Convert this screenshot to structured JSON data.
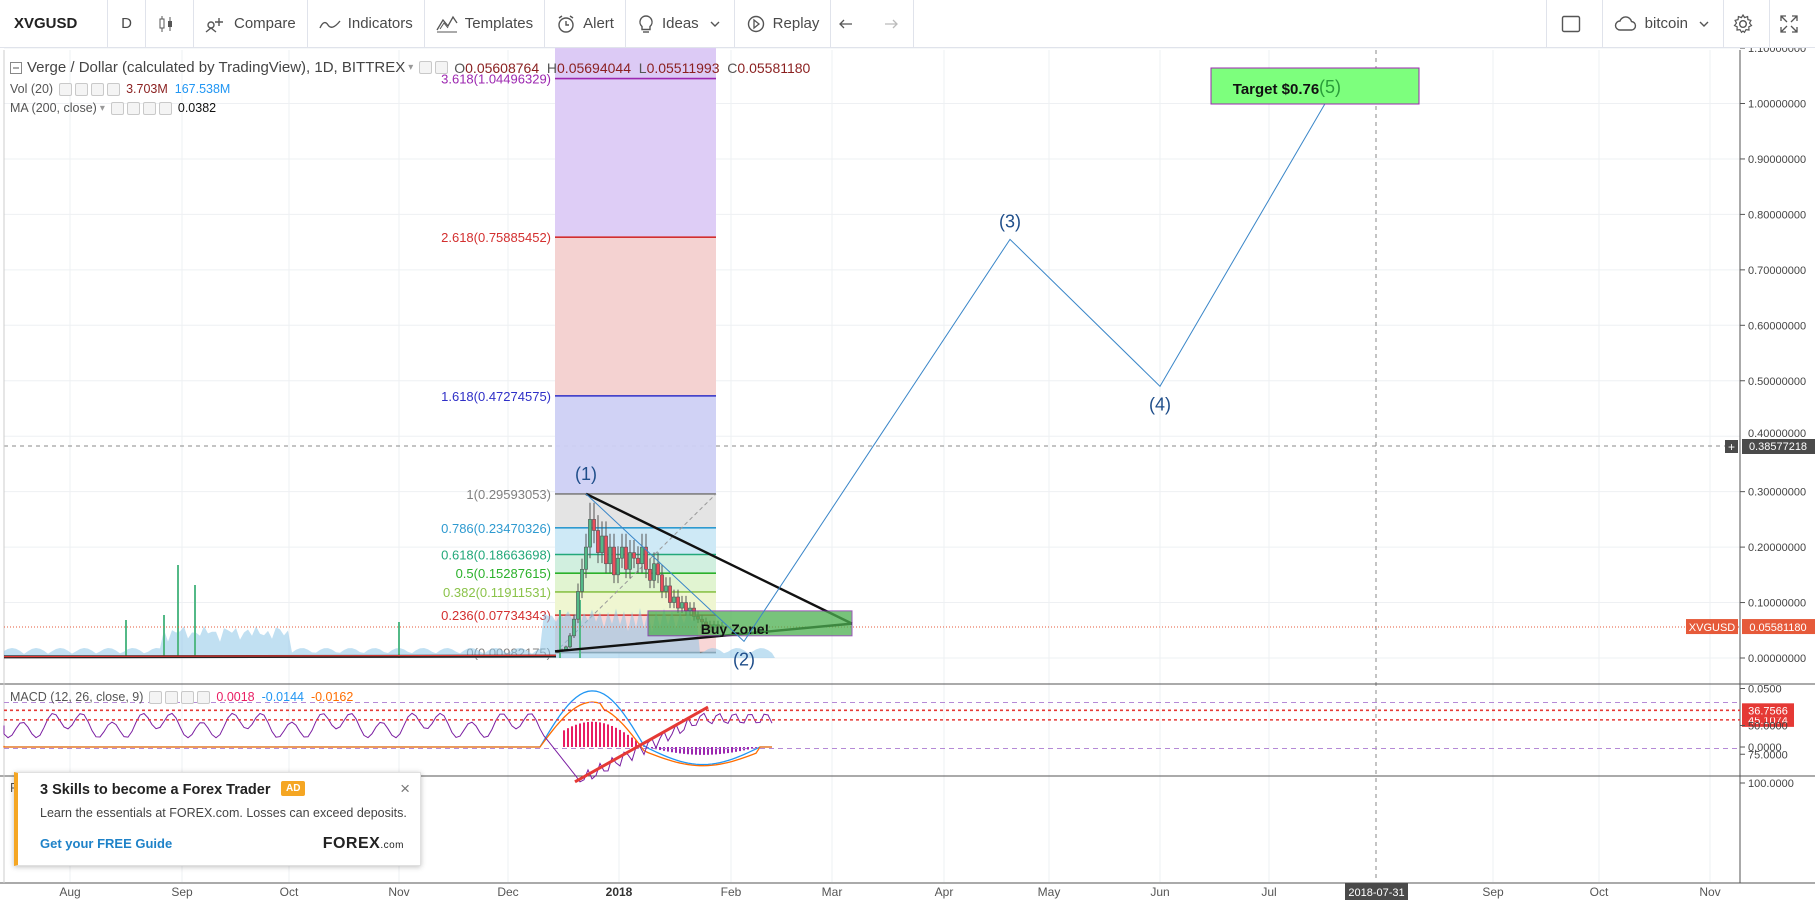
{
  "toolbar": {
    "symbol": "XVGUSD",
    "resolution": "D",
    "compare": "Compare",
    "indicators": "Indicators",
    "templates": "Templates",
    "alert": "Alert",
    "ideas": "Ideas",
    "replay": "Replay",
    "layout_name": "bitcoin",
    "icons": [
      "candles-icon",
      "compare-icon",
      "indicators-icon",
      "templates-icon",
      "alert-icon",
      "ideas-icon",
      "replay-icon",
      "undo-icon",
      "redo-icon",
      "fullscreen-layout-icon",
      "cloud-icon",
      "settings-icon",
      "fullscreen-icon"
    ]
  },
  "legend": {
    "main_title": "Verge / Dollar (calculated by TradingView), 1D, BITTREX",
    "o_label": "O",
    "o_value": "0.05608764",
    "h_label": "H",
    "h_value": "0.05694044",
    "l_label": "L",
    "l_value": "0.05511993",
    "c_label": "C",
    "c_value": "0.05581180",
    "vol_label": "Vol (20)",
    "vol_value1": "3.703M",
    "vol_value2": "167.538M",
    "ma_label": "MA (200, close)",
    "ma_value": "0.0382",
    "macd_label": "MACD (12, 26, close, 9)",
    "macd_value1": "0.0018",
    "macd_value2": "-0.0144",
    "macd_value3": "-0.0162",
    "rsi_label": "R"
  },
  "fib_levels": [
    {
      "label": "3.618(1.04496329)",
      "value": 1.04496329,
      "color": "#9c27b0"
    },
    {
      "label": "2.618(0.75885452)",
      "value": 0.75885452,
      "color": "#d32f2f"
    },
    {
      "label": "1.618(0.47274575)",
      "value": 0.47274575,
      "color": "#2f2fc7"
    },
    {
      "label": "1(0.29593053)",
      "value": 0.29593053,
      "color": "#808080"
    },
    {
      "label": "0.786(0.23470326)",
      "value": 0.23470326,
      "color": "#2e9ad0"
    },
    {
      "label": "0.618(0.18663698)",
      "value": 0.18663698,
      "color": "#22a87a"
    },
    {
      "label": "0.5(0.15287615)",
      "value": 0.15287615,
      "color": "#2bb12b"
    },
    {
      "label": "0.382(0.11911531)",
      "value": 0.11911531,
      "color": "#8bc34a"
    },
    {
      "label": "0.236(0.07734343)",
      "value": 0.07734343,
      "color": "#d32f2f"
    },
    {
      "label": "0(0.00982175)",
      "value": 0.00982175,
      "color": "#808080"
    }
  ],
  "waves": [
    "(1)",
    "(2)",
    "(3)",
    "(4)",
    "(5)"
  ],
  "annotations": {
    "target": "Target $0.76",
    "buy_zone": "Buy Zone!"
  },
  "price_axis": [
    "1.10000000",
    "1.00000000",
    "0.90000000",
    "0.80000000",
    "0.70000000",
    "0.60000000",
    "0.50000000",
    "0.30000000",
    "0.20000000",
    "0.10000000",
    "0.00000000"
  ],
  "price_axis_partial": "0.40000000",
  "crosshair_price": "0.38577218",
  "last_price_symbol": "XVGUSD",
  "last_price": "0.05581180",
  "macd_axis": [
    "0.0500",
    "0.0000"
  ],
  "rsi_axis": [
    "100.0000",
    "75.0000",
    "50.0000"
  ],
  "rsi_tags": [
    "45.1074",
    "36.7566"
  ],
  "time_axis": [
    "Aug",
    "Sep",
    "Oct",
    "Nov",
    "Dec",
    "2018",
    "Feb",
    "Mar",
    "Apr",
    "May",
    "Jun",
    "Jul",
    "Sep",
    "Oct",
    "Nov"
  ],
  "crosshair_date": "2018-07-31",
  "ad": {
    "title": "3 Skills to become a Forex Trader",
    "badge": "AD",
    "description": "Learn the essentials at FOREX.com. Losses can exceed deposits.",
    "cta": "Get your FREE Guide",
    "logo": "FOREX",
    "logo_suffix": ".com",
    "close": "×"
  },
  "colors": {
    "up": "#53b987",
    "down": "#eb4d5c",
    "target_box": "#7dff7d",
    "buy_zone": "#4caf50",
    "wave_line": "#3a86c8",
    "wave_label": "#1f4e8a",
    "macd": "#2196f3",
    "signal": "#ff6d00",
    "rsi": "#7b1fa2"
  }
}
